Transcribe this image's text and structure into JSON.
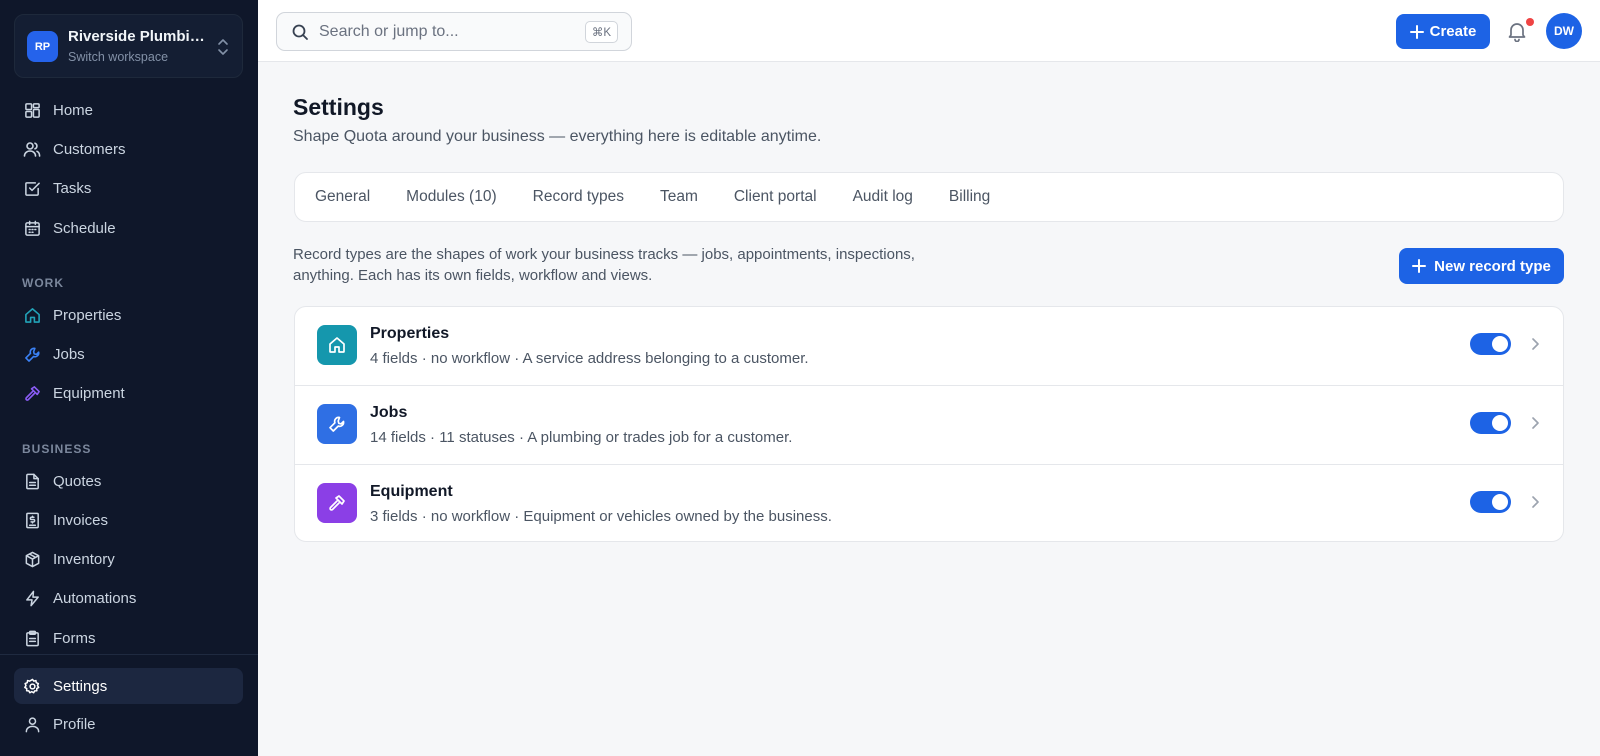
{
  "workspace": {
    "initials": "RP",
    "name": "Riverside Plumbing Co.",
    "subtitle": "Switch workspace"
  },
  "sidebar": {
    "main_items": [
      {
        "label": "Home",
        "icon": "home-grid-icon"
      },
      {
        "label": "Customers",
        "icon": "users-icon"
      },
      {
        "label": "Tasks",
        "icon": "check-square-icon"
      },
      {
        "label": "Schedule",
        "icon": "calendar-icon"
      }
    ],
    "work_heading": "WORK",
    "work_items": [
      {
        "label": "Properties",
        "icon": "house-icon",
        "color": "#22a3b8"
      },
      {
        "label": "Jobs",
        "icon": "wrench-icon",
        "color": "#3b82f6"
      },
      {
        "label": "Equipment",
        "icon": "hammer-icon",
        "color": "#8b5cf6"
      }
    ],
    "business_heading": "BUSINESS",
    "business_items": [
      {
        "label": "Quotes",
        "icon": "document-icon"
      },
      {
        "label": "Invoices",
        "icon": "invoice-icon"
      },
      {
        "label": "Inventory",
        "icon": "box-icon"
      },
      {
        "label": "Automations",
        "icon": "lightning-icon"
      },
      {
        "label": "Forms",
        "icon": "clipboard-icon"
      }
    ],
    "bottom_items": [
      {
        "label": "Settings",
        "icon": "gear-icon",
        "active": true
      },
      {
        "label": "Profile",
        "icon": "user-icon"
      }
    ]
  },
  "topbar": {
    "search_placeholder": "Search or jump to...",
    "shortcut": "⌘K",
    "create_label": "Create",
    "avatar_initials": "DW"
  },
  "page": {
    "title": "Settings",
    "subtitle": "Shape Quota around your business — everything here is editable anytime.",
    "tabs": [
      "General",
      "Modules (10)",
      "Record types",
      "Team",
      "Client portal",
      "Audit log",
      "Billing"
    ],
    "active_tab": "Record types",
    "intro": "Record types are the shapes of work your business tracks — jobs, appointments, inspections, anything. Each has its own fields, workflow and views.",
    "new_button": "New record type"
  },
  "record_types": [
    {
      "name": "Properties",
      "description": "4 fields · no workflow · A service address belonging to a customer.",
      "icon": "house-icon",
      "color": "#1597ad",
      "enabled": true
    },
    {
      "name": "Jobs",
      "description": "14 fields · 11 statuses · A plumbing or trades job for a customer.",
      "icon": "wrench-icon",
      "color": "#2f6fe4",
      "enabled": true
    },
    {
      "name": "Equipment",
      "description": "3 fields · no workflow · Equipment or vehicles owned by the business.",
      "icon": "hammer-icon",
      "color": "#8b3fe6",
      "enabled": true
    }
  ],
  "colors": {
    "accent": "#1d63e5",
    "sidebar_bg": "#0f172a",
    "notification": "#ef4444"
  }
}
